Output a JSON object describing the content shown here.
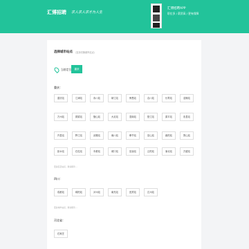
{
  "header": {
    "logo": "汇博招聘",
    "slogan": "求人求人求才为人生",
    "app_title": "汇博招聘APP",
    "app_sub": "职位多 / 薪资高 / 更有保障",
    "brand_color": "#22c39a"
  },
  "main": {
    "title": "选择城市站点",
    "note": "（支持切换城市站点）",
    "location_label": "当前定位：",
    "location_button": "重庆",
    "groups": [
      {
        "label": "重庆：",
        "rows": [
          [
            "重庆站",
            "江津站",
            "永川站",
            "綦江站",
            "荣昌站",
            "合川站",
            "长寿站",
            "涪陵站"
          ],
          [
            "万州站",
            "铜梁站",
            "璧山站",
            "大足站",
            "潼南站",
            "垫江站",
            "梁平站",
            "忠县站"
          ],
          [
            "开县站",
            "黔江站",
            "武隆站",
            "南川站",
            "奉节站",
            "巫山站",
            "酉阳站",
            "秀山站"
          ],
          [
            "彭水站",
            "石柱站",
            "丰都站",
            "城口站",
            "巫溪站",
            "云阳站",
            "渝北站",
            "万盛站"
          ]
        ],
        "note": "更多区县站点，敬请期待 ..."
      },
      {
        "label": "四川：",
        "rows": [
          [
            "成都站",
            "绵阳站",
            "泸州站",
            "南充站",
            "宜宾站",
            "达州站"
          ]
        ],
        "note": "更多城市站点，敬请期待 ..."
      },
      {
        "label": "河北省：",
        "rows": [
          [
            "石家庄"
          ]
        ],
        "note": ""
      }
    ]
  }
}
